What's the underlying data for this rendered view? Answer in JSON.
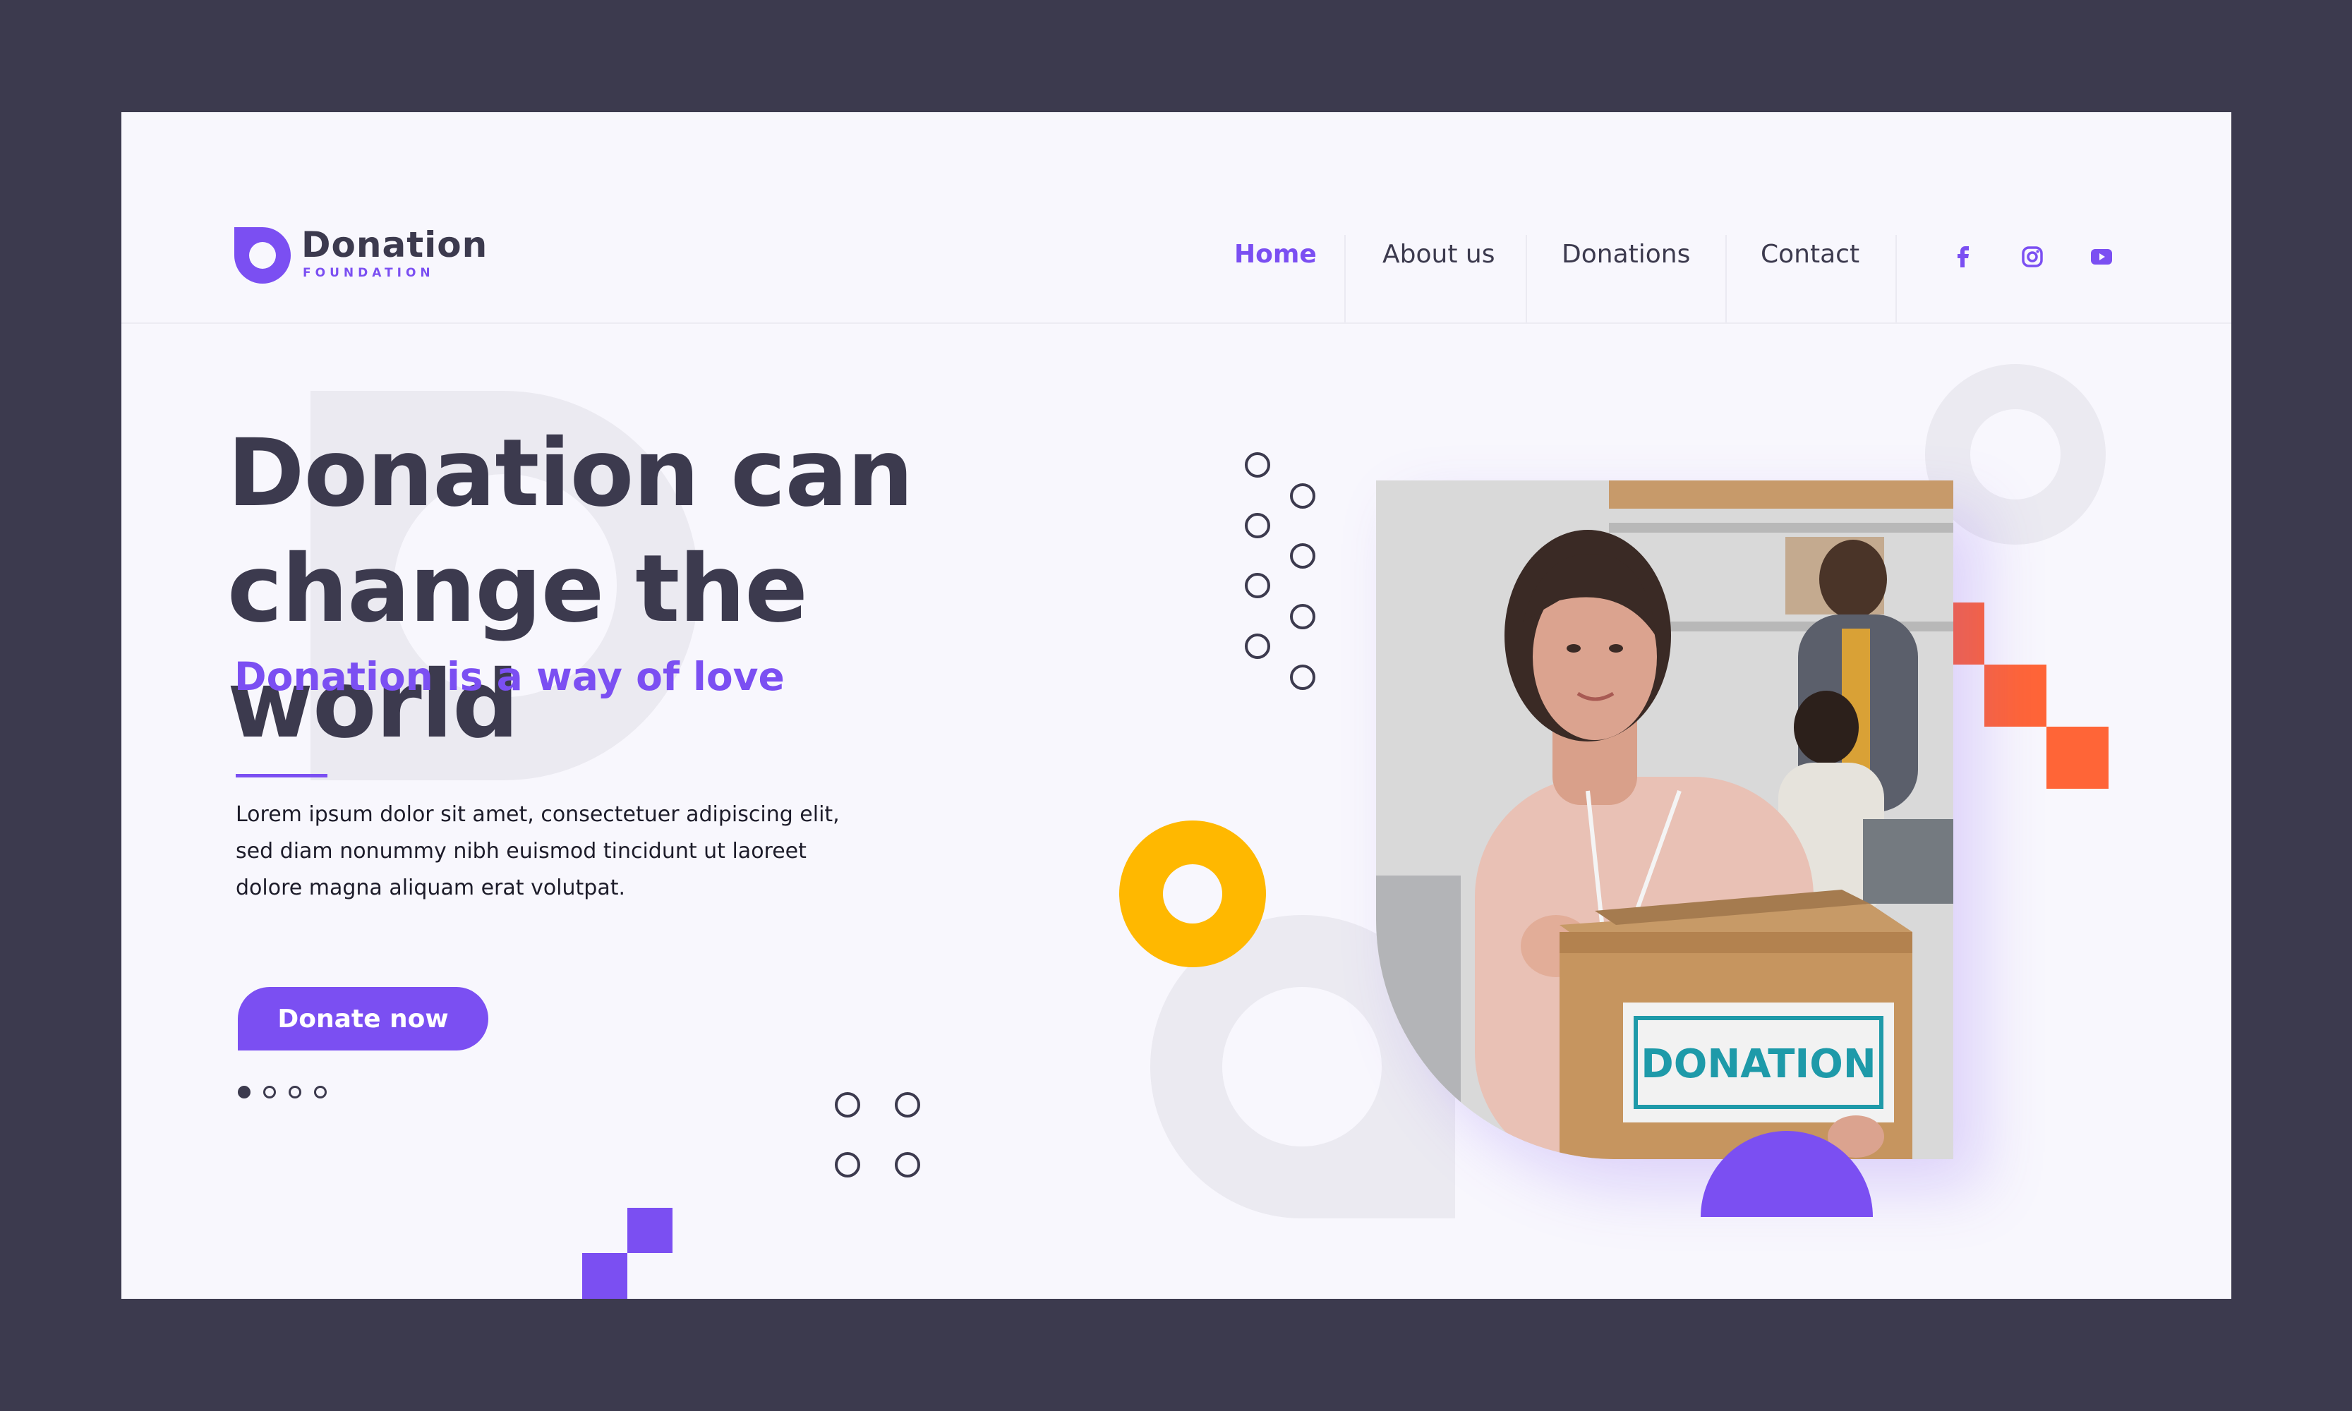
{
  "brand": {
    "name": "Donation",
    "tagline": "FOUNDATION",
    "accent_color": "#7b4ff2",
    "dark_color": "#3c3a4e"
  },
  "nav": {
    "items": [
      {
        "label": "Home",
        "active": true
      },
      {
        "label": "About us",
        "active": false
      },
      {
        "label": "Donations",
        "active": false
      },
      {
        "label": "Contact",
        "active": false
      }
    ],
    "social": [
      "facebook-icon",
      "instagram-icon",
      "youtube-icon"
    ]
  },
  "hero": {
    "title_line1": "Donation can",
    "title_line2": "change the world",
    "subtitle": "Donation is a way of love",
    "body": "Lorem ipsum dolor sit amet, consectetuer adipiscing elit,\nsed diam nonummy nibh euismod tincidunt ut laoreet\ndolore magna aliquam erat volutpat.",
    "cta_label": "Donate now",
    "slides": {
      "total": 4,
      "current": 1
    }
  },
  "photo": {
    "box_label": "DONATION",
    "box_label_color": "#1e9aa9"
  },
  "decor_colors": {
    "yellow": "#ffb800",
    "orange": "#ff6537"
  }
}
